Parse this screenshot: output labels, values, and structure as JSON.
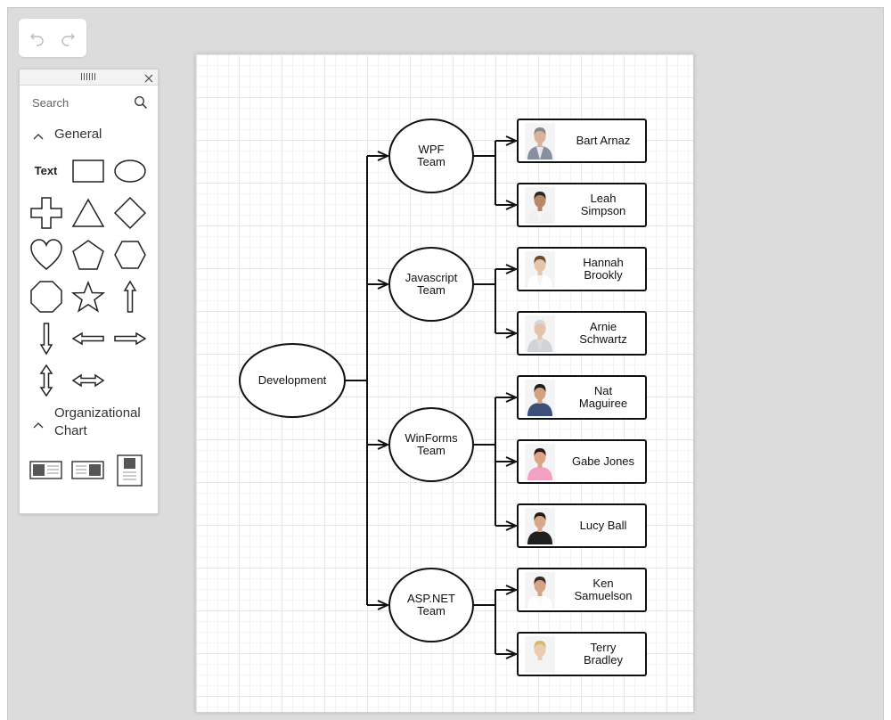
{
  "toolbar": {
    "undo_icon": "undo-icon",
    "redo_icon": "redo-icon"
  },
  "palette": {
    "search_placeholder": "Search",
    "sections": [
      {
        "title": "General",
        "expanded": true
      },
      {
        "title": "Organizational Chart",
        "expanded": true
      }
    ],
    "general_shapes": [
      "Text",
      "rectangle",
      "ellipse",
      "plus",
      "triangle",
      "diamond",
      "heart",
      "pentagon",
      "hexagon",
      "octagon",
      "star",
      "arrow-up",
      "arrow-down",
      "arrow-left",
      "arrow-right",
      "arrow-up-down",
      "arrow-left-right"
    ],
    "org_shapes": [
      "org-card-photo-left",
      "org-card-photo-right",
      "org-card-photo-top"
    ]
  },
  "diagram": {
    "root": {
      "label": "Development"
    },
    "teams": [
      {
        "label": "WPF\nTeam",
        "members": [
          {
            "name": "Bart Arnaz",
            "photo": {
              "shirt": "#e8e8f0",
              "jacket": "#8a8fa0",
              "skin": "#d8b39a",
              "hair": "#888888"
            }
          },
          {
            "name": "Leah\nSimpson",
            "photo": {
              "shirt": "#f6f6f6",
              "jacket": "#f0f0f0",
              "skin": "#b98866",
              "hair": "#2a2a2a"
            }
          }
        ]
      },
      {
        "label": "Javascript\nTeam",
        "members": [
          {
            "name": "Hannah\nBrookly",
            "photo": {
              "shirt": "#f5f5f5",
              "jacket": "#ffffff",
              "skin": "#e7c4a8",
              "hair": "#6b4a2e"
            }
          },
          {
            "name": "Arnie\nSchwartz",
            "photo": {
              "shirt": "#dcdcdc",
              "jacket": "#cfd4d8",
              "skin": "#e6c2ad",
              "hair": "#d8d8d8"
            }
          }
        ]
      },
      {
        "label": "WinForms\nTeam",
        "members": [
          {
            "name": "Nat\nMaguiree",
            "photo": {
              "shirt": "#3b4f7a",
              "jacket": "#3b4f7a",
              "skin": "#d0a27f",
              "hair": "#1e1e1e"
            }
          },
          {
            "name": "Gabe Jones",
            "photo": {
              "shirt": "#f2a0c3",
              "jacket": "#f2a0c3",
              "skin": "#dba487",
              "hair": "#2b1a12"
            }
          },
          {
            "name": "Lucy Ball",
            "photo": {
              "shirt": "#202020",
              "jacket": "#202020",
              "skin": "#d7a98c",
              "hair": "#2a1b10"
            }
          }
        ]
      },
      {
        "label": "ASP.NET\nTeam",
        "members": [
          {
            "name": "Ken\nSamuelson",
            "photo": {
              "shirt": "#fafafa",
              "jacket": "#ffffff",
              "skin": "#d4a585",
              "hair": "#3a2a1e"
            }
          },
          {
            "name": "Terry\nBradley",
            "photo": {
              "shirt": "#f4f4f4",
              "jacket": "#f4f4f4",
              "skin": "#ecccb0",
              "hair": "#d9b86a"
            }
          }
        ]
      }
    ]
  }
}
